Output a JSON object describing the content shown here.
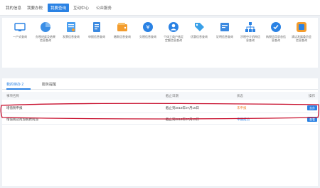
{
  "nav": {
    "tabs": [
      {
        "label": "我的信息"
      },
      {
        "label": "我要办税"
      },
      {
        "label": "我要查询"
      },
      {
        "label": "互动中心"
      },
      {
        "label": "公众服务"
      }
    ],
    "active_index": 2
  },
  "services": [
    {
      "label": "一户式查询",
      "color": "#2a82e4",
      "icon": "monitor-icon"
    },
    {
      "label": "办税进度及结果信息查询",
      "color": "#3a8ee6",
      "icon": "pie-chart-icon"
    },
    {
      "label": "发票信息查询",
      "color": "#4a9ff0",
      "icon": "invoice-icon"
    },
    {
      "label": "申报信息查询",
      "color": "#3b89e0",
      "icon": "document-icon"
    },
    {
      "label": "缴款信息查询",
      "color": "#f39c2d",
      "icon": "wallet-icon"
    },
    {
      "label": "欠税信息查询",
      "color": "#2a82e4",
      "icon": "coin-icon"
    },
    {
      "label": "个体工商户核定定额信息查询",
      "color": "#2a82e4",
      "icon": "user-icon"
    },
    {
      "label": "优惠信息查询",
      "color": "#39a0e8",
      "icon": "tag-icon"
    },
    {
      "label": "证明信息查询",
      "color": "#3b89e0",
      "icon": "certificate-icon"
    },
    {
      "label": "涉税中介机构信息查询",
      "color": "#2a82e4",
      "icon": "org-chart-icon"
    },
    {
      "label": "纳税信用状态信息查询",
      "color": "#2a82e4",
      "icon": "credit-icon"
    },
    {
      "label": "清洁发展委员会信息查询",
      "color": "#f39c2d",
      "icon": "tile-icon"
    }
  ],
  "todo": {
    "tabs": [
      {
        "label": "我的待办 2"
      },
      {
        "label": "服务提醒"
      }
    ],
    "headers": {
      "name": "事项名称",
      "deadline": "截止日期",
      "status": "状态",
      "action": "操作"
    },
    "rows": [
      {
        "name": "增值税申报",
        "deadline": "截止到2019年07月15日",
        "status": "未申报",
        "status_color": "#f08a3a",
        "action": "去办"
      },
      {
        "name": "增值税及附加税费附加",
        "deadline": "截止到2019年07月15日",
        "status": "申报成功",
        "status_color": "#2a82e4",
        "action": "查看"
      }
    ]
  },
  "colors": {
    "accent": "#2a82e4",
    "highlight": "#c8102e",
    "warning": "#f08a3a"
  }
}
